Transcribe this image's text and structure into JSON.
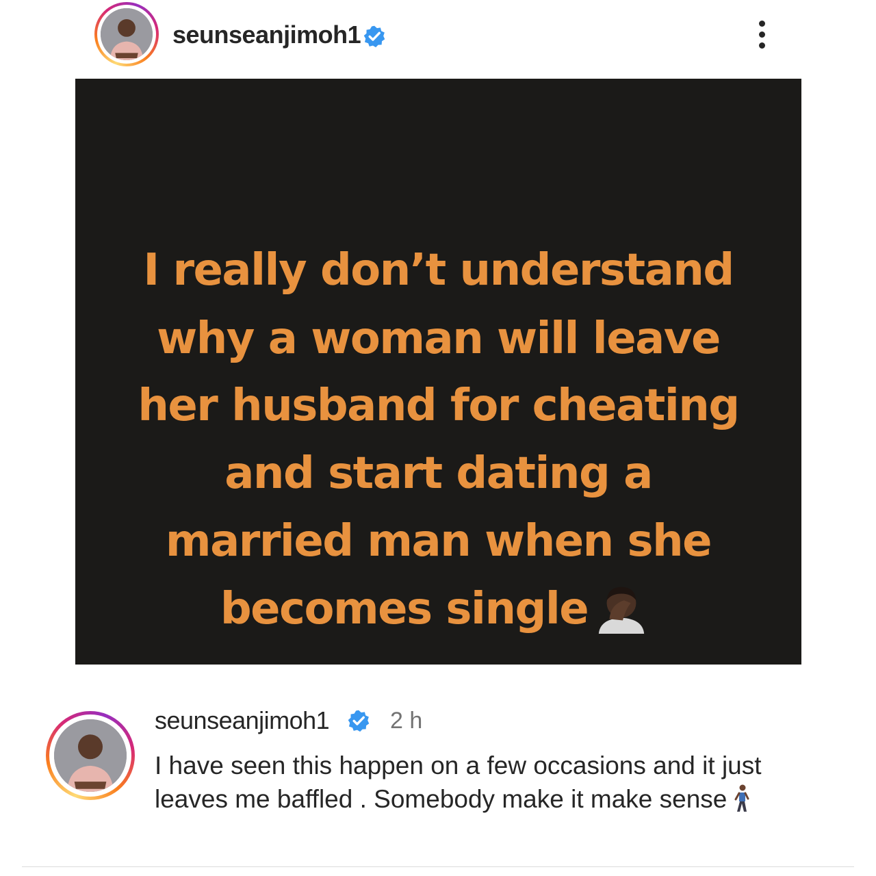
{
  "post": {
    "username": "seunseanjimoh1",
    "verified_icon": "verified-badge-icon",
    "more_icon": "more-options-icon",
    "image_text_lines": [
      "I really don’t understand",
      "why a woman will leave",
      "her husband for cheating",
      "and start dating a",
      "married man when she",
      "becomes single"
    ],
    "image_emoji": "facepalm-emoji",
    "colors": {
      "background": "#1b1a18",
      "text": "#e8923f"
    }
  },
  "comment": {
    "username": "seunseanjimoh1",
    "time": "2 h",
    "text": "I have seen this happen on a few occasions  and it just leaves me baffled . Somebody make it make sense",
    "emoji": "person-walking-emoji"
  },
  "colors": {
    "verified": "#3897f0",
    "muted": "#737373"
  }
}
